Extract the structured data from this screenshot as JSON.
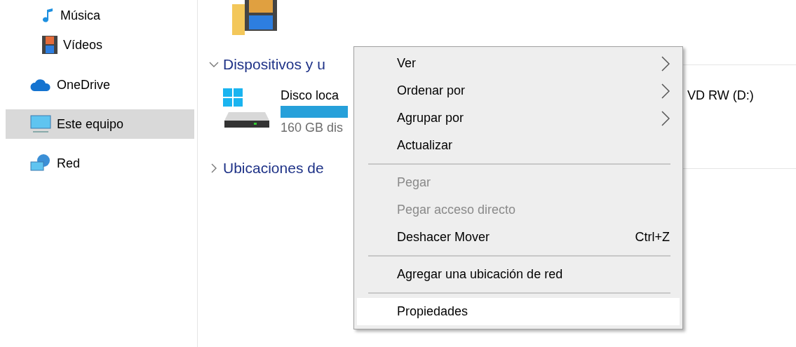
{
  "sidebar": {
    "nested_items": [
      {
        "label": "Música",
        "selected": false
      },
      {
        "label": "Vídeos",
        "selected": false
      }
    ],
    "items": [
      {
        "label": "OneDrive",
        "selected": false
      },
      {
        "label": "Este equipo",
        "selected": true
      },
      {
        "label": "Red",
        "selected": false
      }
    ]
  },
  "content": {
    "sections": [
      {
        "title": "Dispositivos y u",
        "expanded": true,
        "drives": [
          {
            "name": "Disco loca",
            "free": "160 GB dis",
            "level": 1
          },
          {
            "name": "VD RW (D:)"
          }
        ]
      },
      {
        "title": "Ubicaciones de",
        "expanded": false
      }
    ]
  },
  "context_menu": {
    "items": [
      {
        "kind": "item",
        "label": "Ver",
        "submenu": true,
        "disabled": false,
        "selected": false
      },
      {
        "kind": "item",
        "label": "Ordenar por",
        "submenu": true,
        "disabled": false,
        "selected": false
      },
      {
        "kind": "item",
        "label": "Agrupar por",
        "submenu": true,
        "disabled": false,
        "selected": false
      },
      {
        "kind": "item",
        "label": "Actualizar",
        "submenu": false,
        "disabled": false,
        "selected": false
      },
      {
        "kind": "separator"
      },
      {
        "kind": "item",
        "label": "Pegar",
        "submenu": false,
        "disabled": true,
        "selected": false
      },
      {
        "kind": "item",
        "label": "Pegar acceso directo",
        "submenu": false,
        "disabled": true,
        "selected": false
      },
      {
        "kind": "item",
        "label": "Deshacer Mover",
        "shortcut": "Ctrl+Z",
        "submenu": false,
        "disabled": false,
        "selected": false
      },
      {
        "kind": "separator"
      },
      {
        "kind": "item",
        "label": "Agregar una ubicación de red",
        "submenu": false,
        "disabled": false,
        "selected": false
      },
      {
        "kind": "separator"
      },
      {
        "kind": "item",
        "label": "Propiedades",
        "submenu": false,
        "disabled": false,
        "selected": true
      }
    ]
  }
}
